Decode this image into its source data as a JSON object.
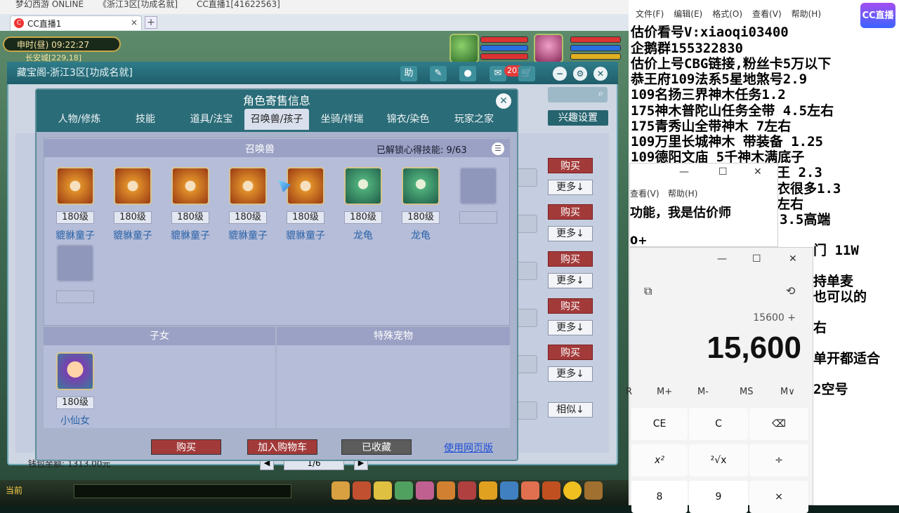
{
  "topbar": {
    "left_text": "梦幻西游 ONLINE",
    "mid_text": "《浙江3区[功成名就]",
    "right_text": "CC直播1[41622563]"
  },
  "browser": {
    "tab_label": "CC直播1",
    "tab_close": "×",
    "new_tab": "+",
    "favicon": "cc-logo-icon"
  },
  "game_hud": {
    "clock": "申时(昼)  09:22:27",
    "location": "长安城[229,18]"
  },
  "outer_window": {
    "title": "藏宝阁-浙江3区[功成名就]",
    "help": "助",
    "msg_count": "201",
    "interest_button": "兴趣设置",
    "rows": [
      {
        "buy": "购买",
        "more": "更多↓"
      },
      {
        "buy": "购买",
        "more": "更多↓"
      },
      {
        "buy": "购买",
        "more": "更多↓"
      },
      {
        "buy": "购买",
        "more": "更多↓"
      },
      {
        "buy": "购买",
        "more": "更多↓"
      },
      {
        "more": "相似↓"
      }
    ],
    "wallet": "钱包余额: 1313.00元",
    "page": "1/6"
  },
  "modal": {
    "title": "角色寄售信息",
    "tabs": [
      "人物/修炼",
      "技能",
      "道具/法宝",
      "召唤兽/孩子",
      "坐骑/祥瑞",
      "锦衣/染色",
      "玩家之家"
    ],
    "active_tab": 3,
    "pet_section_title": "召唤兽",
    "skills_label": "已解锁心得技能: 9/63",
    "pets": [
      {
        "level": "180级",
        "name": "貔貅童子",
        "kind": "tongzi"
      },
      {
        "level": "180级",
        "name": "貔貅童子",
        "kind": "tongzi"
      },
      {
        "level": "180级",
        "name": "貔貅童子",
        "kind": "tongzi"
      },
      {
        "level": "180级",
        "name": "貔貅童子",
        "kind": "tongzi"
      },
      {
        "level": "180级",
        "name": "貔貅童子",
        "kind": "tongzi"
      },
      {
        "level": "180级",
        "name": "龙龟",
        "kind": "turtle"
      },
      {
        "level": "180级",
        "name": "龙龟",
        "kind": "turtle"
      }
    ],
    "kids_title": "子女",
    "kid": {
      "level": "180级",
      "name": "小仙女"
    },
    "special_title": "特殊宠物",
    "buttons": {
      "buy": "购买",
      "add_cart": "加入购物车",
      "collected": "已收藏",
      "web": "使用网页版"
    }
  },
  "gamebar": {
    "current": "当前"
  },
  "notepad": {
    "menu": [
      "文件(F)",
      "编辑(E)",
      "格式(O)",
      "查看(V)",
      "帮助(H)"
    ],
    "lines": [
      "估价看号V:xiaoqi03400",
      "企鹅群155322830",
      "估价上号CBG链接,粉丝卡5万以下",
      "恭王府109法系5星地煞号2.9",
      "109名扬三界神木任务1.2",
      "175神木普陀山任务全带 4.5左右",
      "175青秀山全带神木  7左右",
      "109万里长城神木 带装备  1.25",
      "109德阳文庙 5千神木满底子",
      "王 2.3",
      "衣很多1.3",
      "左右",
      "3.5高端",
      "门 11W",
      "持单麦",
      "也可以的",
      "右",
      "单开都适合",
      "2空号"
    ],
    "cc_logo": "CC直播"
  },
  "win2": {
    "menu": [
      "查看(V)",
      "帮助(H)"
    ],
    "text": "功能，我是估价师",
    "text2": "0+"
  },
  "calculator": {
    "expression": "15600 +",
    "display": "15,600",
    "memory": [
      "M+",
      "M-",
      "MS",
      "M∨"
    ],
    "rows": [
      [
        "CE",
        "C",
        "⌫"
      ],
      [
        "x²",
        "²√x",
        "÷"
      ],
      [
        "8",
        "9",
        "×"
      ]
    ]
  }
}
